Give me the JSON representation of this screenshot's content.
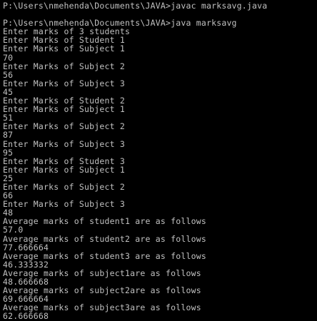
{
  "console": {
    "lines": [
      "P:\\Users\\nmehenda\\Documents\\JAVA>javac marksavg.java",
      "",
      "P:\\Users\\nmehenda\\Documents\\JAVA>java marksavg",
      "Enter marks of 3 students",
      "Enter Marks of Student 1",
      "Enter Marks of Subject 1",
      "70",
      "Enter Marks of Subject 2",
      "56",
      "Enter Marks of Subject 3",
      "45",
      "Enter Marks of Student 2",
      "Enter Marks of Subject 1",
      "51",
      "Enter Marks of Subject 2",
      "87",
      "Enter Marks of Subject 3",
      "95",
      "Enter Marks of Student 3",
      "Enter Marks of Subject 1",
      "25",
      "Enter Marks of Subject 2",
      "66",
      "Enter Marks of Subject 3",
      "48",
      "Average marks of student1 are as follows",
      "57.0",
      "Average marks of student2 are as follows",
      "77.666664",
      "Average marks of student3 are as follows",
      "46.333332",
      "Average marks of subject1are as follows",
      "48.666668",
      "Average marks of subject2are as follows",
      "69.666664",
      "Average marks of subject3are as follows",
      "62.666668"
    ],
    "colors": {
      "background": "#000000",
      "text": "#c0c0c0"
    }
  }
}
